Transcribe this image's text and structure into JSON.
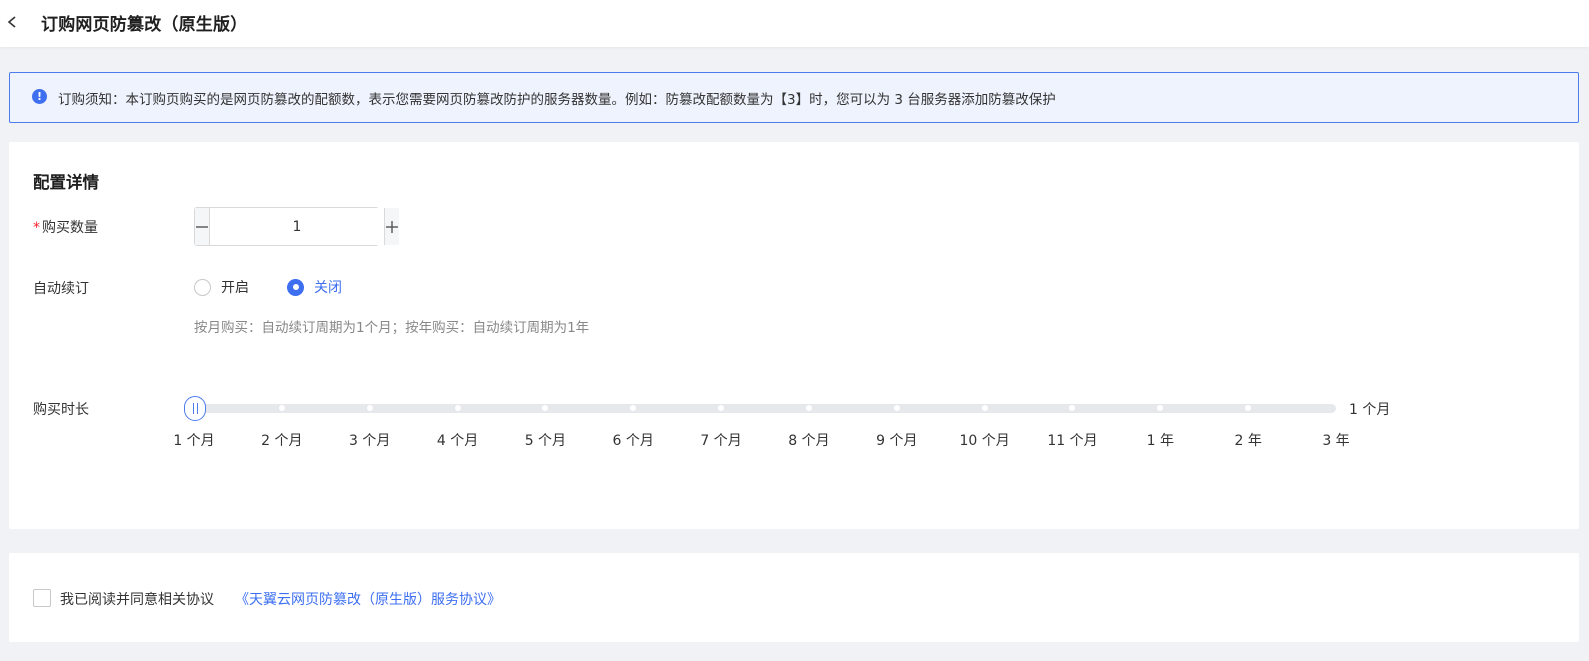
{
  "header": {
    "title": "订购网页防篡改（原生版）",
    "back_icon": "chevron-left-icon"
  },
  "notice": {
    "icon": "info-circle-icon",
    "icon_glyph": "!",
    "text": "订购须知：本订购页购买的是网页防篡改的配额数，表示您需要网页防篡改防护的服务器数量。例如：防篡改配额数量为【3】时，您可以为 3 台服务器添加防篡改保护",
    "accent_color": "#3d6ff0"
  },
  "config": {
    "section_title": "配置详情",
    "quantity": {
      "required_mark": "*",
      "label": "购买数量",
      "value": "1",
      "minus_glyph": "—",
      "plus_glyph": "+"
    },
    "auto_renew": {
      "label": "自动续订",
      "options": [
        {
          "label": "开启",
          "checked": false
        },
        {
          "label": "关闭",
          "checked": true
        }
      ],
      "hint": "按月购买：自动续订周期为1个月；按年购买：自动续订周期为1年"
    },
    "duration": {
      "label": "购买时长",
      "selected_index": 0,
      "current_value": "1 个月",
      "ticks": [
        "1 个月",
        "2 个月",
        "3 个月",
        "4 个月",
        "5 个月",
        "6 个月",
        "7 个月",
        "8 个月",
        "9 个月",
        "10 个月",
        "11 个月",
        "1 年",
        "2 年",
        "3 年"
      ]
    }
  },
  "agreement": {
    "checked": false,
    "text": "我已阅读并同意相关协议",
    "link_text": "《天翼云网页防篡改（原生版）服务协议》"
  }
}
